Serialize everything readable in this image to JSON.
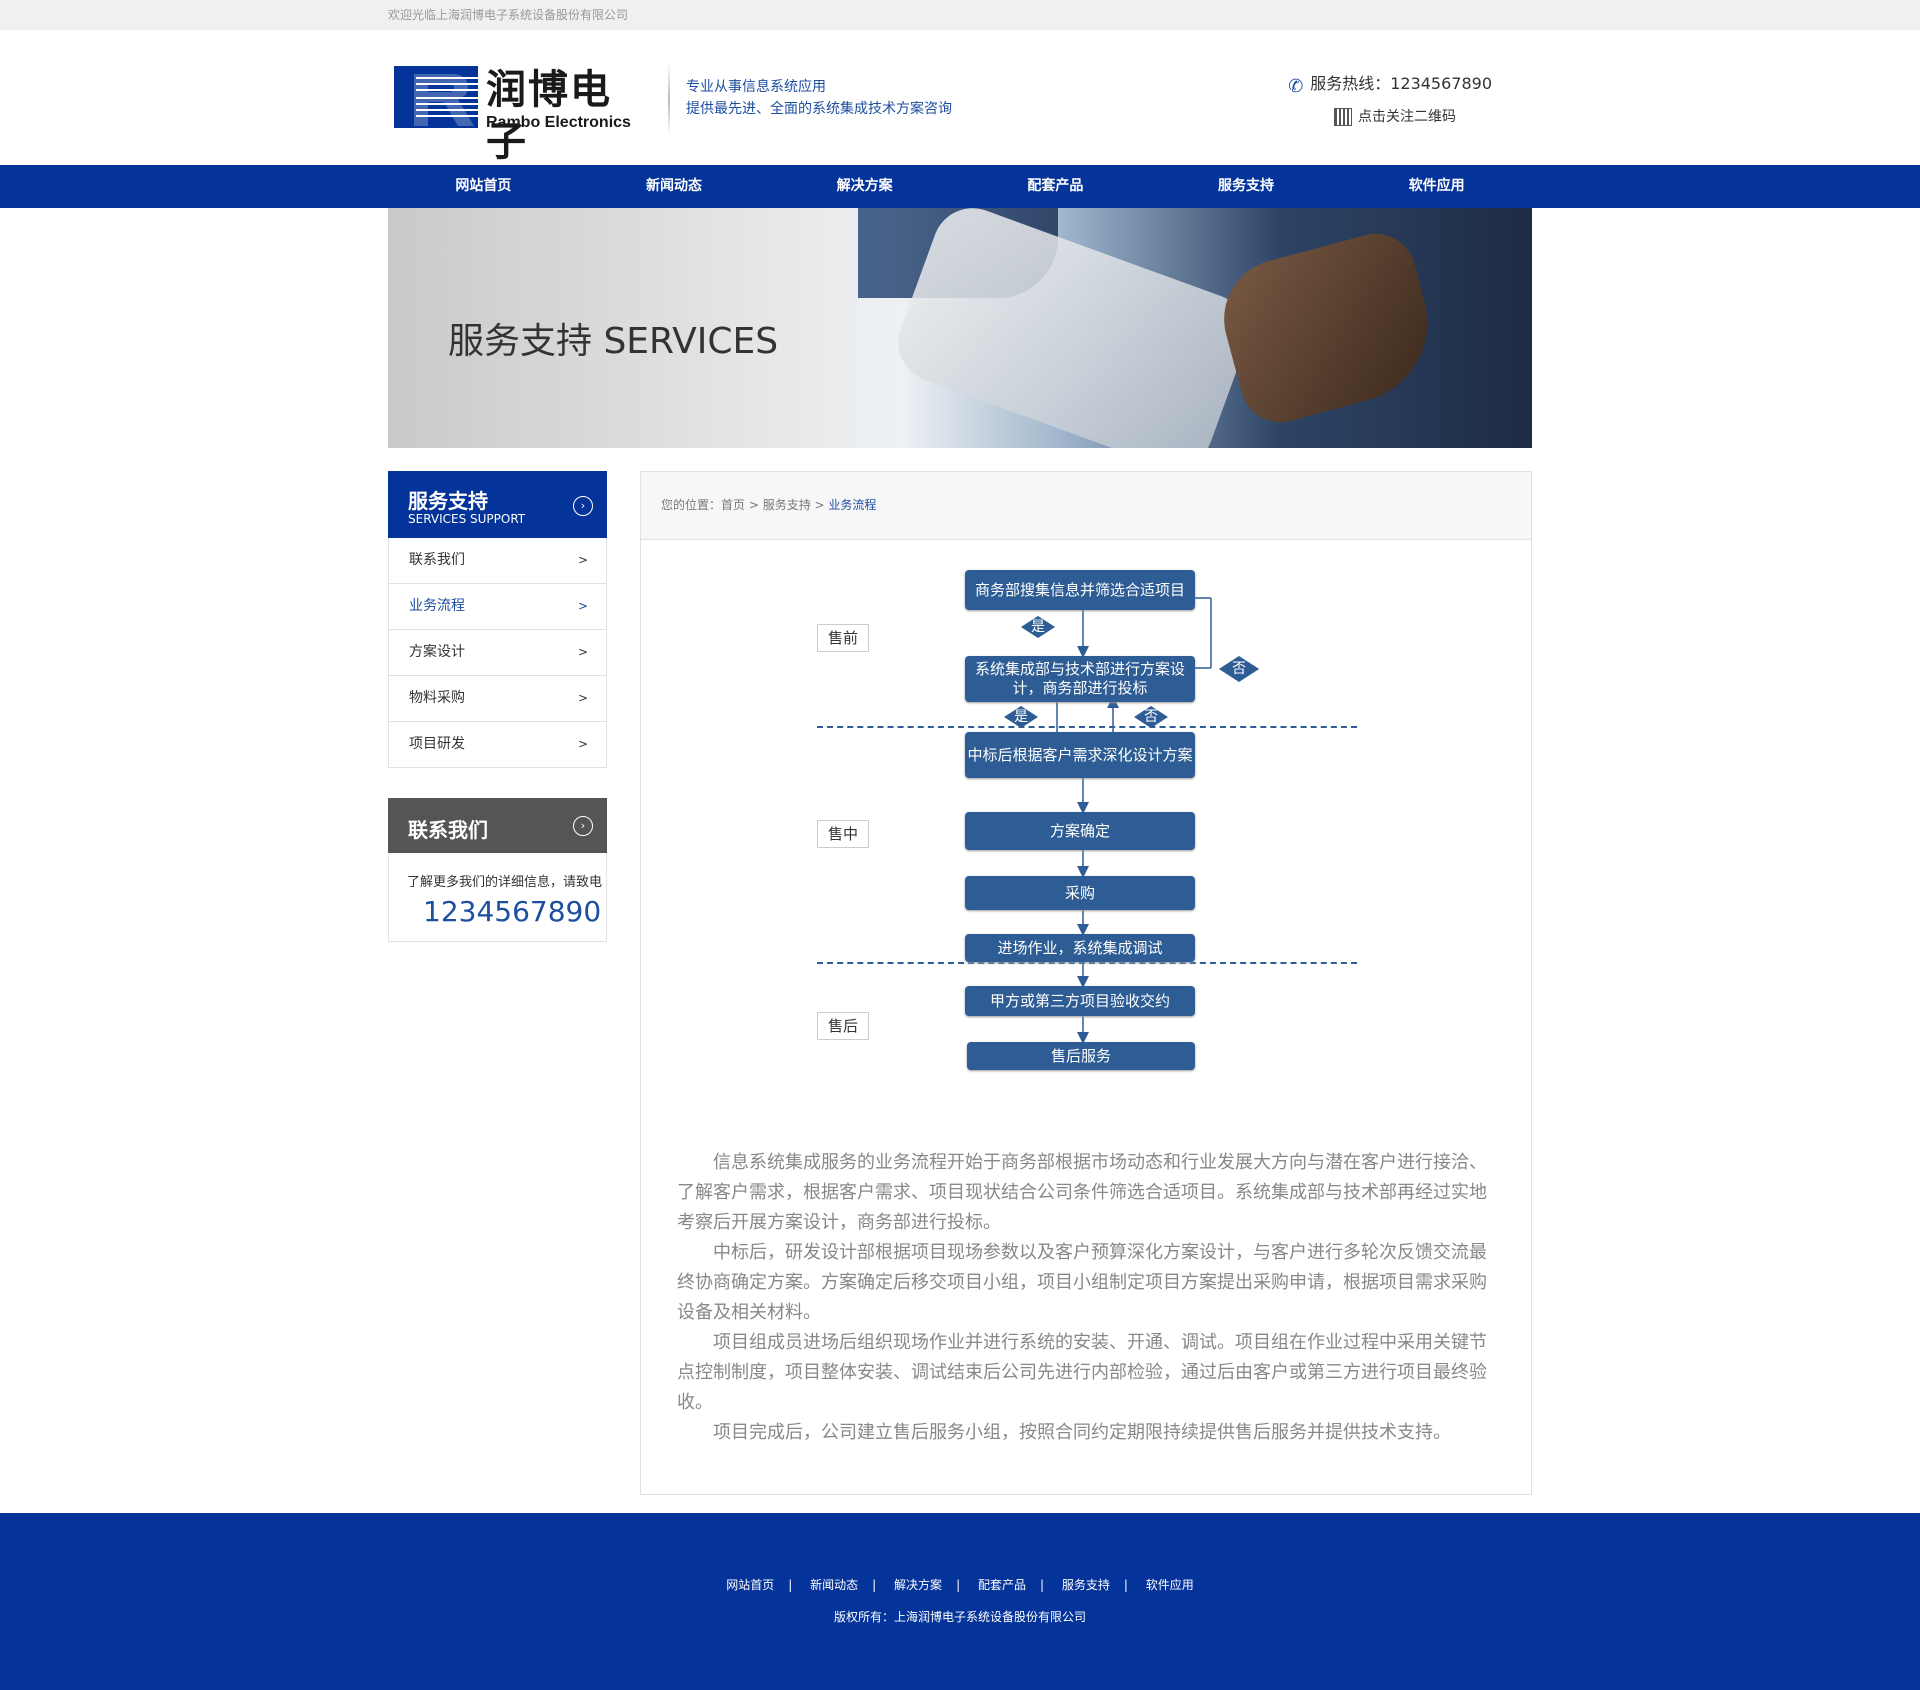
{
  "topbar": {
    "welcome": "欢迎光临上海润博电子系统设备股份有限公司"
  },
  "header": {
    "logo_cn": "润博电子",
    "logo_en": "Rambo Electronics",
    "slogan_line1": "专业从事信息系统应用",
    "slogan_line2": "提供最先进、全面的系统集成技术方案咨询",
    "hotline_label": "服务热线：",
    "hotline_number": "1234567890",
    "qr_label": "点击关注二维码"
  },
  "nav": {
    "items": [
      "网站首页",
      "新闻动态",
      "解决方案",
      "配套产品",
      "服务支持",
      "软件应用"
    ]
  },
  "banner": {
    "title": "服务支持 SERVICES"
  },
  "sidebar": {
    "title": "服务支持",
    "subtitle": "SERVICES SUPPORT",
    "items": [
      {
        "label": "联系我们",
        "arrow": ">"
      },
      {
        "label": "业务流程",
        "arrow": ">",
        "active": true
      },
      {
        "label": "方案设计",
        "arrow": ">"
      },
      {
        "label": "物料采购",
        "arrow": ">"
      },
      {
        "label": "项目研发",
        "arrow": ">"
      }
    ]
  },
  "contact": {
    "title": "联系我们",
    "text": "了解更多我们的详细信息，请致电",
    "phone": "1234567890"
  },
  "breadcrumb": {
    "prefix": "您的位置：",
    "home": "首页",
    "sep": " > ",
    "section": "服务支持",
    "sep2": " > ",
    "current": "业务流程"
  },
  "flow": {
    "phases": [
      "售前",
      "售中",
      "售后"
    ],
    "steps": [
      "商务部搜集信息并筛选合适项目",
      "系统集成部与技术部进行方案设计，商务部进行投标",
      "中标后根据客户需求深化设计方案",
      "方案确定",
      "采购",
      "进场作业，系统集成调试",
      "甲方或第三方项目验收交约",
      "售后服务"
    ],
    "decisions": {
      "yes": "是",
      "no": "否"
    }
  },
  "description": [
    "信息系统集成服务的业务流程开始于商务部根据市场动态和行业发展大方向与潜在客户进行接洽、了解客户需求，根据客户需求、项目现状结合公司条件筛选合适项目。系统集成部与技术部再经过实地考察后开展方案设计，商务部进行投标。",
    "中标后，研发设计部根据项目现场参数以及客户预算深化方案设计，与客户进行多轮次反馈交流最终协商确定方案。方案确定后移交项目小组，项目小组制定项目方案提出采购申请，根据项目需求采购设备及相关材料。",
    "项目组成员进场后组织现场作业并进行系统的安装、开通、调试。项目组在作业过程中采用关键节点控制制度，项目整体安装、调试结束后公司先进行内部检验，通过后由客户或第三方进行项目最终验收。",
    "项目完成后，公司建立售后服务小组，按照合同约定期限持续提供售后服务并提供技术支持。"
  ],
  "footer": {
    "nav": [
      "网站首页",
      "新闻动态",
      "解决方案",
      "配套产品",
      "服务支持",
      "软件应用"
    ],
    "sep": "|",
    "copyright": "版权所有：上海润博电子系统设备股份有限公司"
  },
  "colors": {
    "brand": "#04339a",
    "flow_box": "#2d5d94"
  }
}
